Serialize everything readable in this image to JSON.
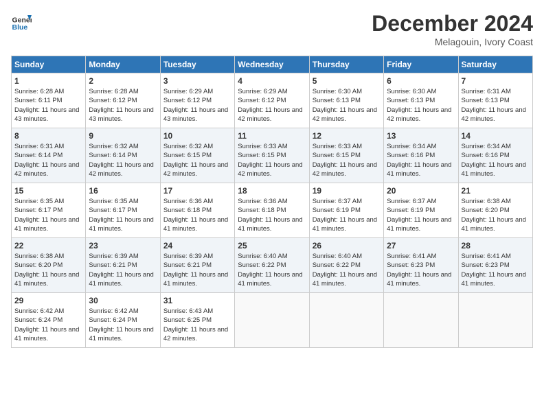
{
  "header": {
    "logo_line1": "General",
    "logo_line2": "Blue",
    "month_title": "December 2024",
    "location": "Melagouin, Ivory Coast"
  },
  "days_of_week": [
    "Sunday",
    "Monday",
    "Tuesday",
    "Wednesday",
    "Thursday",
    "Friday",
    "Saturday"
  ],
  "weeks": [
    [
      {
        "num": "1",
        "sunrise": "6:28 AM",
        "sunset": "6:11 PM",
        "daylight": "11 hours and 43 minutes."
      },
      {
        "num": "2",
        "sunrise": "6:28 AM",
        "sunset": "6:12 PM",
        "daylight": "11 hours and 43 minutes."
      },
      {
        "num": "3",
        "sunrise": "6:29 AM",
        "sunset": "6:12 PM",
        "daylight": "11 hours and 43 minutes."
      },
      {
        "num": "4",
        "sunrise": "6:29 AM",
        "sunset": "6:12 PM",
        "daylight": "11 hours and 42 minutes."
      },
      {
        "num": "5",
        "sunrise": "6:30 AM",
        "sunset": "6:13 PM",
        "daylight": "11 hours and 42 minutes."
      },
      {
        "num": "6",
        "sunrise": "6:30 AM",
        "sunset": "6:13 PM",
        "daylight": "11 hours and 42 minutes."
      },
      {
        "num": "7",
        "sunrise": "6:31 AM",
        "sunset": "6:13 PM",
        "daylight": "11 hours and 42 minutes."
      }
    ],
    [
      {
        "num": "8",
        "sunrise": "6:31 AM",
        "sunset": "6:14 PM",
        "daylight": "11 hours and 42 minutes."
      },
      {
        "num": "9",
        "sunrise": "6:32 AM",
        "sunset": "6:14 PM",
        "daylight": "11 hours and 42 minutes."
      },
      {
        "num": "10",
        "sunrise": "6:32 AM",
        "sunset": "6:15 PM",
        "daylight": "11 hours and 42 minutes."
      },
      {
        "num": "11",
        "sunrise": "6:33 AM",
        "sunset": "6:15 PM",
        "daylight": "11 hours and 42 minutes."
      },
      {
        "num": "12",
        "sunrise": "6:33 AM",
        "sunset": "6:15 PM",
        "daylight": "11 hours and 42 minutes."
      },
      {
        "num": "13",
        "sunrise": "6:34 AM",
        "sunset": "6:16 PM",
        "daylight": "11 hours and 41 minutes."
      },
      {
        "num": "14",
        "sunrise": "6:34 AM",
        "sunset": "6:16 PM",
        "daylight": "11 hours and 41 minutes."
      }
    ],
    [
      {
        "num": "15",
        "sunrise": "6:35 AM",
        "sunset": "6:17 PM",
        "daylight": "11 hours and 41 minutes."
      },
      {
        "num": "16",
        "sunrise": "6:35 AM",
        "sunset": "6:17 PM",
        "daylight": "11 hours and 41 minutes."
      },
      {
        "num": "17",
        "sunrise": "6:36 AM",
        "sunset": "6:18 PM",
        "daylight": "11 hours and 41 minutes."
      },
      {
        "num": "18",
        "sunrise": "6:36 AM",
        "sunset": "6:18 PM",
        "daylight": "11 hours and 41 minutes."
      },
      {
        "num": "19",
        "sunrise": "6:37 AM",
        "sunset": "6:19 PM",
        "daylight": "11 hours and 41 minutes."
      },
      {
        "num": "20",
        "sunrise": "6:37 AM",
        "sunset": "6:19 PM",
        "daylight": "11 hours and 41 minutes."
      },
      {
        "num": "21",
        "sunrise": "6:38 AM",
        "sunset": "6:20 PM",
        "daylight": "11 hours and 41 minutes."
      }
    ],
    [
      {
        "num": "22",
        "sunrise": "6:38 AM",
        "sunset": "6:20 PM",
        "daylight": "11 hours and 41 minutes."
      },
      {
        "num": "23",
        "sunrise": "6:39 AM",
        "sunset": "6:21 PM",
        "daylight": "11 hours and 41 minutes."
      },
      {
        "num": "24",
        "sunrise": "6:39 AM",
        "sunset": "6:21 PM",
        "daylight": "11 hours and 41 minutes."
      },
      {
        "num": "25",
        "sunrise": "6:40 AM",
        "sunset": "6:22 PM",
        "daylight": "11 hours and 41 minutes."
      },
      {
        "num": "26",
        "sunrise": "6:40 AM",
        "sunset": "6:22 PM",
        "daylight": "11 hours and 41 minutes."
      },
      {
        "num": "27",
        "sunrise": "6:41 AM",
        "sunset": "6:23 PM",
        "daylight": "11 hours and 41 minutes."
      },
      {
        "num": "28",
        "sunrise": "6:41 AM",
        "sunset": "6:23 PM",
        "daylight": "11 hours and 41 minutes."
      }
    ],
    [
      {
        "num": "29",
        "sunrise": "6:42 AM",
        "sunset": "6:24 PM",
        "daylight": "11 hours and 41 minutes."
      },
      {
        "num": "30",
        "sunrise": "6:42 AM",
        "sunset": "6:24 PM",
        "daylight": "11 hours and 41 minutes."
      },
      {
        "num": "31",
        "sunrise": "6:43 AM",
        "sunset": "6:25 PM",
        "daylight": "11 hours and 42 minutes."
      },
      null,
      null,
      null,
      null
    ]
  ]
}
